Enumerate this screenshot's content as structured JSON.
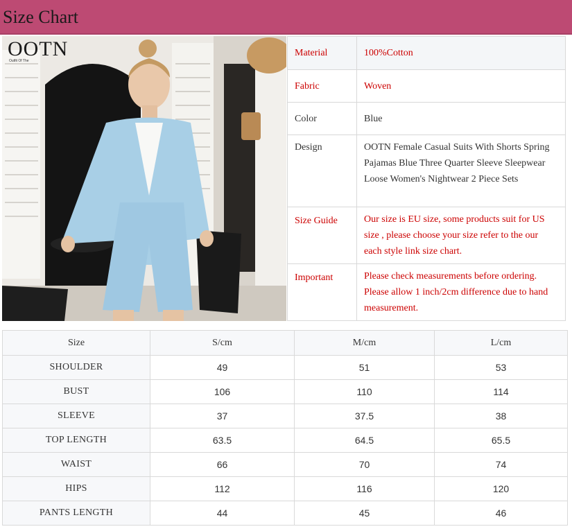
{
  "header": {
    "title": "Size Chart"
  },
  "photo": {
    "brand": "OOTN",
    "brand_sub": "Outfit  Of  The"
  },
  "info": [
    {
      "label": "Material",
      "value": "100%Cotton",
      "color": "red"
    },
    {
      "label": "Fabric",
      "value": "Woven",
      "color": "red"
    },
    {
      "label": "Color",
      "value": "Blue",
      "color": "dark"
    },
    {
      "label": "Design",
      "value": "OOTN Female Casual Suits With Shorts Spring Pajamas Blue Three Quarter Sleeve Sleepwear Loose Women's Nightwear 2 Piece Sets",
      "color": "dark"
    },
    {
      "label": "Size Guide",
      "value": "Our size is EU size, some products suit for US size , please choose your size refer to the our each style link size chart.",
      "color": "red"
    },
    {
      "label": "Important",
      "value": "Please check measurements before ordering. Please allow 1 inch/2cm difference due to hand measurement.",
      "color": "red"
    }
  ],
  "size_table": {
    "headers": [
      "Size",
      "S/cm",
      "M/cm",
      "L/cm"
    ],
    "rows": [
      [
        "SHOULDER",
        "49",
        "51",
        "53"
      ],
      [
        "BUST",
        "106",
        "110",
        "114"
      ],
      [
        "SLEEVE",
        "37",
        "37.5",
        "38"
      ],
      [
        "TOP LENGTH",
        "63.5",
        "64.5",
        "65.5"
      ],
      [
        "WAIST",
        "66",
        "70",
        "74"
      ],
      [
        "HIPS",
        "112",
        "116",
        "120"
      ],
      [
        "PANTS LENGTH",
        "44",
        "45",
        "46"
      ]
    ]
  },
  "colors": {
    "header_bg": "#bd4a73",
    "accent_red": "#cc0000",
    "garment_blue": "#a8cfe6"
  }
}
